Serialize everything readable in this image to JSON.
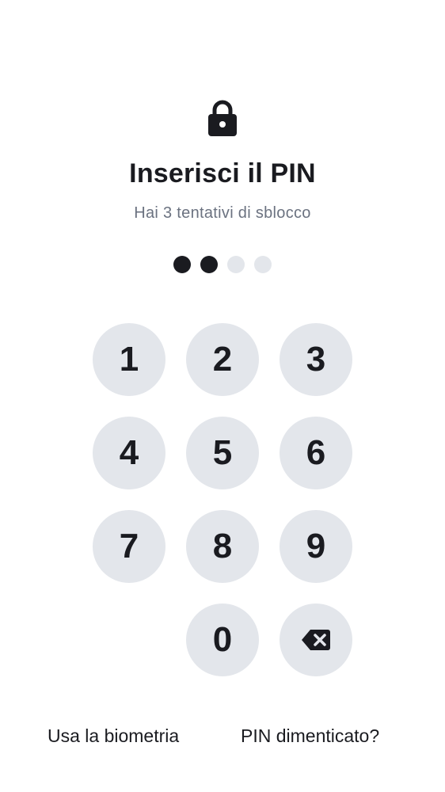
{
  "header": {
    "icon": "lock-icon",
    "title": "Inserisci il PIN",
    "subtitle": "Hai 3 tentativi di sblocco"
  },
  "pin": {
    "length": 4,
    "entered": 2
  },
  "keypad": {
    "keys": [
      "1",
      "2",
      "3",
      "4",
      "5",
      "6",
      "7",
      "8",
      "9",
      "",
      "0",
      "backspace"
    ],
    "backspace_icon": "backspace-icon"
  },
  "footer": {
    "biometric_label": "Usa la biometria",
    "forgot_label": "PIN dimenticato?"
  },
  "colors": {
    "text": "#1a1b20",
    "muted": "#6b7280",
    "key_bg": "#e3e6eb",
    "dot_empty": "#e3e6eb",
    "dot_filled": "#1a1b20"
  }
}
